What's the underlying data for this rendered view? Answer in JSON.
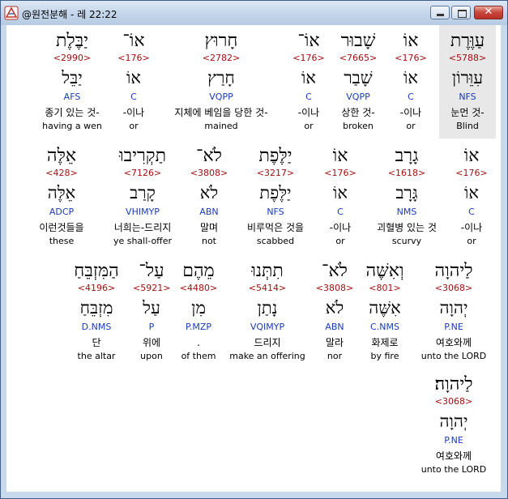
{
  "window": {
    "title": "@원전분해 - 레 22:22"
  },
  "rows": [
    {
      "words": [
        {
          "heb": "עַוֶּרֶת",
          "strong": "<5788>",
          "root": "עִוֵּרוֹן",
          "parse": "NFS",
          "kor": "눈먼 것-",
          "eng": "Blind"
        },
        {
          "heb": "אוֹ",
          "strong": "<176>",
          "root": "אוֹ",
          "parse": "C",
          "kor": "-이나",
          "eng": "or"
        },
        {
          "heb": "שָׁבוּר",
          "strong": "<7665>",
          "root": "שָׁבַר",
          "parse": "VQPP",
          "kor": "상한 것-",
          "eng": "broken"
        },
        {
          "heb": "אוֹ־",
          "strong": "<176>",
          "root": "אוֹ",
          "parse": "C",
          "kor": "-이나",
          "eng": "or"
        },
        {
          "heb": "חָרוּץ",
          "strong": "<2782>",
          "root": "חָרַץ",
          "parse": "VQPP",
          "kor": "지체에 베임을 당한 것-",
          "eng": "mained"
        },
        {
          "heb": "אוֹ־",
          "strong": "<176>",
          "root": "אוֹ",
          "parse": "C",
          "kor": "-이나",
          "eng": "or"
        },
        {
          "heb": "יַבֶּלֶת",
          "strong": "<2990>",
          "root": "יַבֵּל",
          "parse": "AFS",
          "kor": "종기 있는 것-",
          "eng": "having a wen"
        }
      ]
    },
    {
      "words": [
        {
          "heb": "אוֹ",
          "strong": "<176>",
          "root": "אוֹ",
          "parse": "C",
          "kor": "-이나",
          "eng": "or"
        },
        {
          "heb": "גָרָב",
          "strong": "<1618>",
          "root": "גָּרָב",
          "parse": "NMS",
          "kor": "괴혈병 있는 것",
          "eng": "scurvy"
        },
        {
          "heb": "אוֹ",
          "strong": "<176>",
          "root": "אוֹ",
          "parse": "C",
          "kor": "-이나",
          "eng": "or"
        },
        {
          "heb": "יַלֶּפֶת",
          "strong": "<3217>",
          "root": "יַלֶּפֶת",
          "parse": "NFS",
          "kor": "비루먹은 것을",
          "eng": "scabbed"
        },
        {
          "heb": "לֹא־",
          "strong": "<3808>",
          "root": "לֹא",
          "parse": "ABN",
          "kor": "말며",
          "eng": "not"
        },
        {
          "heb": "תַקְרִיבוּ",
          "strong": "<7126>",
          "root": "קָרַב",
          "parse": "VHIMYP",
          "kor": "너희는-드리지",
          "eng": "ye shall-offer"
        },
        {
          "heb": "אֵלֶּה",
          "strong": "<428>",
          "root": "אֵלֶּה",
          "parse": "ADCP",
          "kor": "이런것들을",
          "eng": "these"
        }
      ]
    },
    {
      "words": [
        {
          "heb": "לַיהוָה",
          "strong": "<3068>",
          "root": "יְהוָה",
          "parse": "P.NE",
          "kor": "여호와께",
          "eng": "unto the LORD"
        },
        {
          "heb": "וְאִשֶּׁה",
          "strong": "<801>",
          "root": "אִשֶּׁה",
          "parse": "C.NMS",
          "kor": "화제로",
          "eng": "by fire"
        },
        {
          "heb": "לֹא־",
          "strong": "<3808>",
          "root": "לֹא",
          "parse": "ABN",
          "kor": "말라",
          "eng": "nor"
        },
        {
          "heb": "תִתְּנוּ",
          "strong": "<5414>",
          "root": "נָתַן",
          "parse": "VQIMYP",
          "kor": "드리지",
          "eng": "make an offering"
        },
        {
          "heb": "מֵהֶם",
          "strong": "<4480>",
          "root": "מִן",
          "parse": "P.MZP",
          "kor": ".",
          "eng": "of them"
        },
        {
          "heb": "עַל־",
          "strong": "<5921>",
          "root": "עַל",
          "parse": "P",
          "kor": "위에",
          "eng": "upon"
        },
        {
          "heb": "הַמִּזְבֵּחַ",
          "strong": "<4196>",
          "root": "מִזְבֵּחַ",
          "parse": "D.NMS",
          "kor": "단",
          "eng": "the altar"
        }
      ]
    },
    {
      "words": [
        {
          "heb": "לַיהוָה׃",
          "strong": "<3068>",
          "root": "יְהוָה",
          "parse": "P.NE",
          "kor": "여호와께",
          "eng": "unto the LORD"
        }
      ]
    }
  ]
}
